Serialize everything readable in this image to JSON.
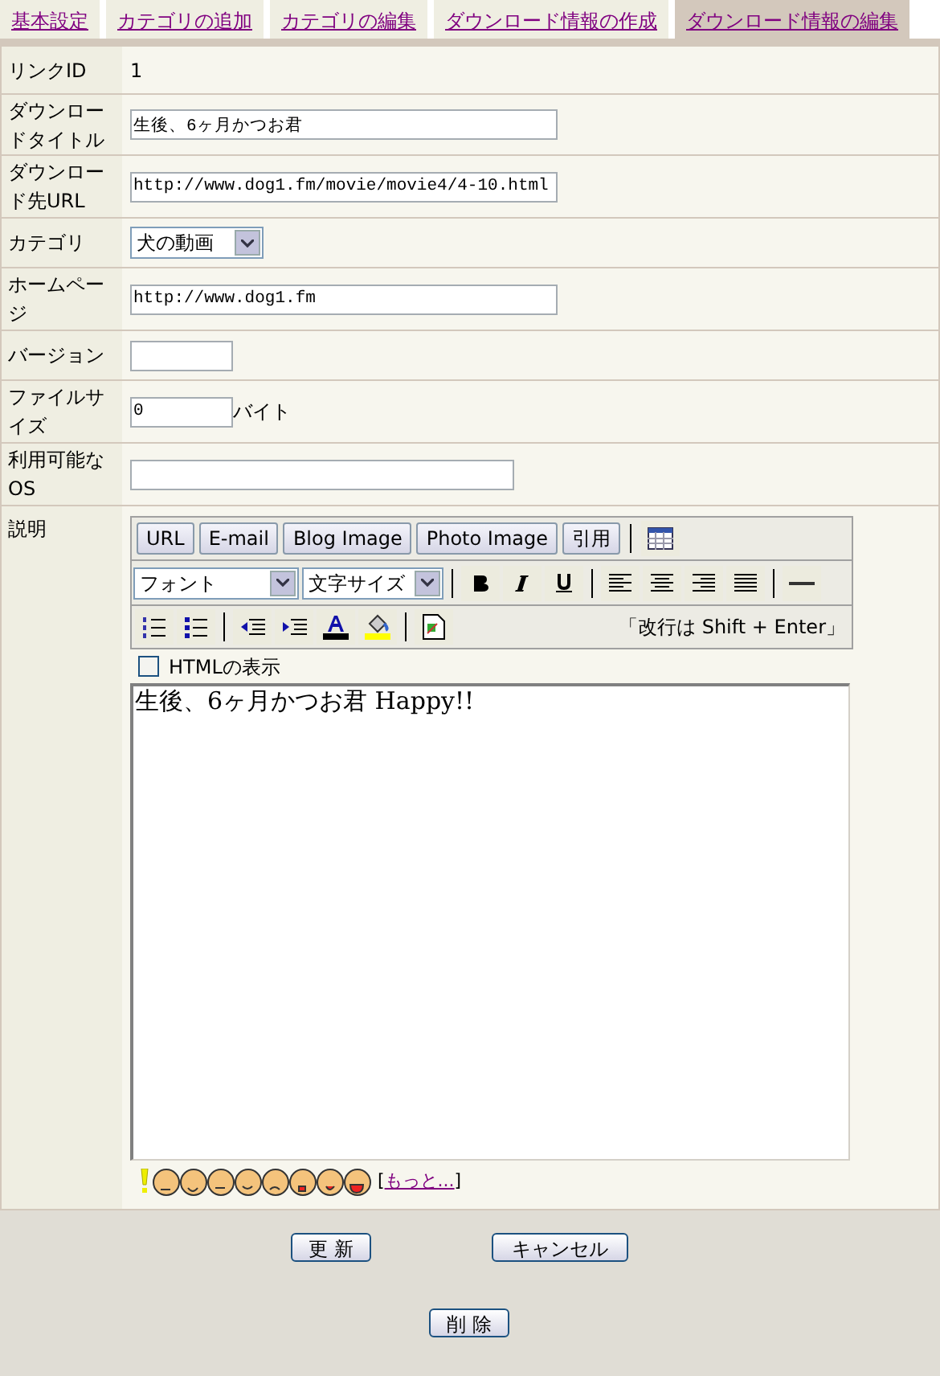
{
  "tabs": [
    {
      "label": "基本設定",
      "selected": false
    },
    {
      "label": "カテゴリの追加",
      "selected": false
    },
    {
      "label": "カテゴリの編集",
      "selected": false
    },
    {
      "label": "ダウンロード情報の作成",
      "selected": false
    },
    {
      "label": "ダウンロード情報の編集",
      "selected": true
    }
  ],
  "form": [
    {
      "label": "リンクID",
      "kind": "text",
      "value": "1"
    },
    {
      "label": "ダウンロードタイトル",
      "kind": "wide_input",
      "value": "生後、6ヶ月かつお君"
    },
    {
      "label": "ダウンロード先URL",
      "kind": "wide_input",
      "value": "http://www.dog1.fm/movie/movie4/4-10.html"
    },
    {
      "label": "カテゴリ",
      "kind": "select",
      "value": "犬の動画"
    },
    {
      "label": "ホームページ",
      "kind": "wide_input",
      "value": "http://www.dog1.fm"
    },
    {
      "label": "バージョン",
      "kind": "short_input"
    },
    {
      "label": "ファイルサイズ",
      "kind": "short_input",
      "value": "0",
      "suffix": "バイト"
    },
    {
      "label": "利用可能なOS",
      "kind": "medium_input"
    },
    {
      "label": "説明",
      "kind": "editor"
    }
  ],
  "editor": {
    "insert_buttons": [
      "URL",
      "E-mail",
      "Blog Image",
      "Photo Image",
      "引用"
    ],
    "font_select": "フォント",
    "size_select": "文字サイズ",
    "hint": "「改行は Shift + Enter」",
    "html_view": {
      "label": "HTMLの表示",
      "checked": false
    },
    "content": "生後、6ヶ月かつお君 Happy!!",
    "more_link": "もっと...",
    "more_open": "[",
    "more_close": "]"
  },
  "footer": {
    "update": "更 新",
    "cancel": "キャンセル",
    "delete": "削 除"
  }
}
